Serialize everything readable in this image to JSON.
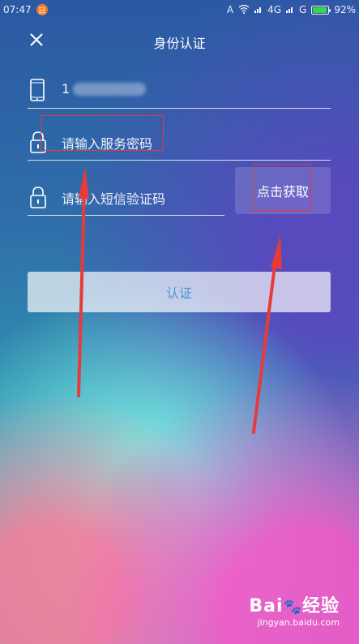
{
  "status_bar": {
    "time": "07:47",
    "notification_badge": "日",
    "signal_text": "4G",
    "net_text": "G",
    "battery_percent": "92%",
    "battery_level": 0.92
  },
  "header": {
    "title": "身份认证"
  },
  "form": {
    "phone_value": "1",
    "password_placeholder": "请输入服务密码",
    "sms_placeholder": "请输入短信验证码",
    "get_code_label": "点击获取",
    "submit_label": "认证"
  },
  "colors": {
    "annotation_red": "#e23b3b",
    "battery_green": "#39d64b",
    "submit_text": "#3c8cc8"
  },
  "watermark": {
    "logo_text": "Bai",
    "logo_suffix": "经验",
    "url": "jingyan.baidu.com"
  }
}
